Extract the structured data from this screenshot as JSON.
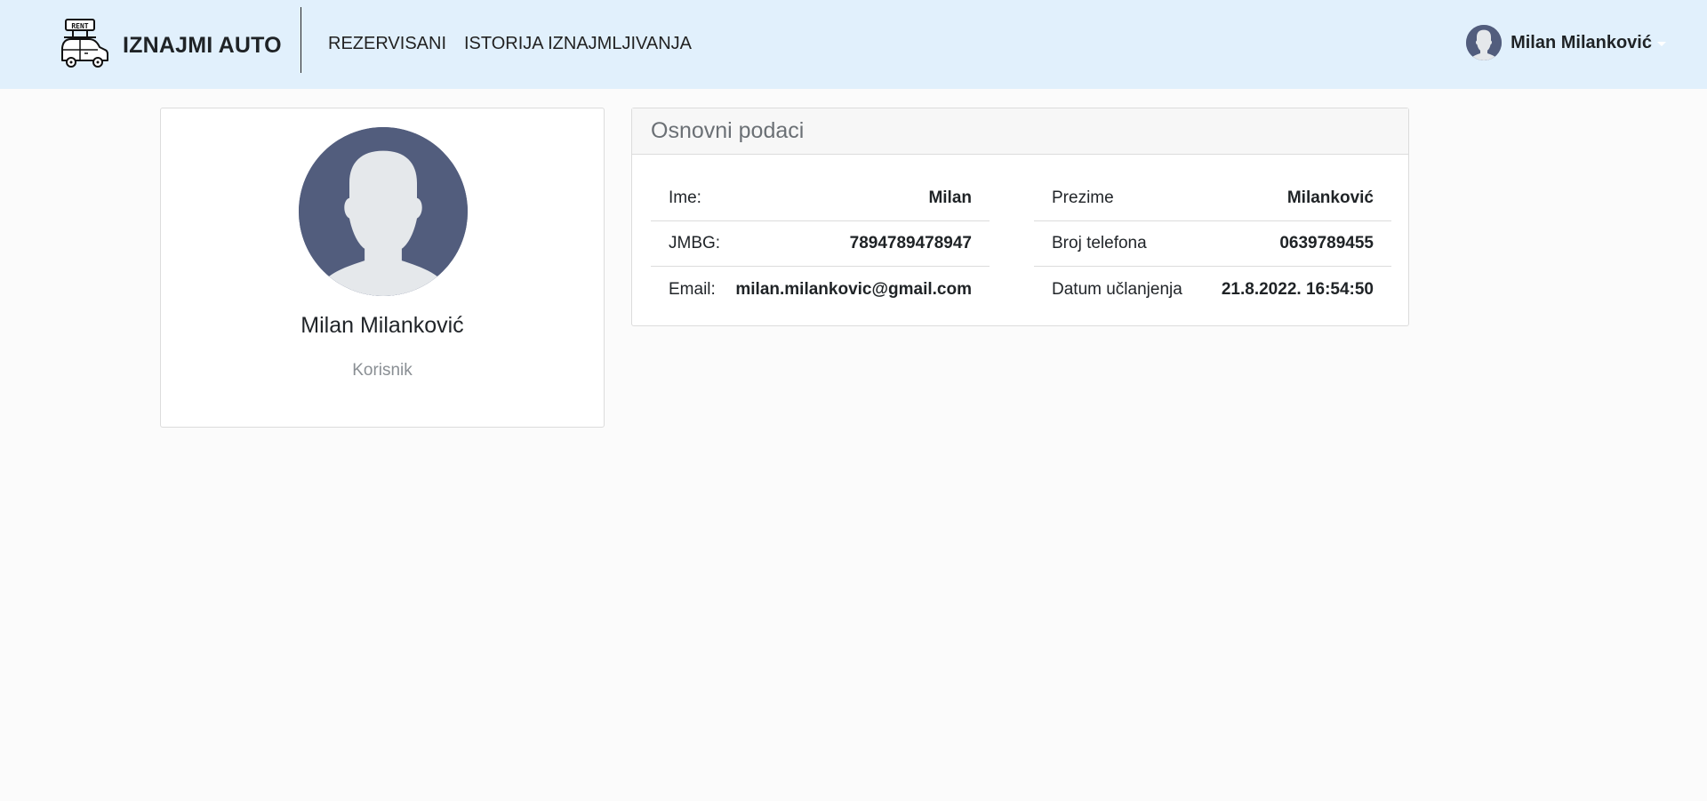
{
  "navbar": {
    "brand_icon_text": "RENT",
    "brand_title": "IZNAJMI AUTO",
    "links": [
      {
        "label": "REZERVISANI"
      },
      {
        "label": "ISTORIJA IZNAJMLJIVANJA"
      }
    ],
    "user_name": "Milan Milanković"
  },
  "profile": {
    "name": "Milan Milanković",
    "role": "Korisnik"
  },
  "info": {
    "title": "Osnovni podaci",
    "left": [
      {
        "label": "Ime:",
        "value": "Milan"
      },
      {
        "label": "JMBG:",
        "value": "7894789478947"
      },
      {
        "label": "Email:",
        "value": "milan.milankovic@gmail.com"
      }
    ],
    "right": [
      {
        "label": "Prezime",
        "value": "Milanković"
      },
      {
        "label": "Broj telefona",
        "value": "0639789455"
      },
      {
        "label": "Datum učlanjenja",
        "value": "21.8.2022. 16:54:50"
      }
    ]
  },
  "colors": {
    "navbar_bg": "#e1f0fc",
    "page_bg": "#fbfbfb",
    "avatar_bg": "#525d7d",
    "avatar_silhouette": "#e5e8eb"
  }
}
